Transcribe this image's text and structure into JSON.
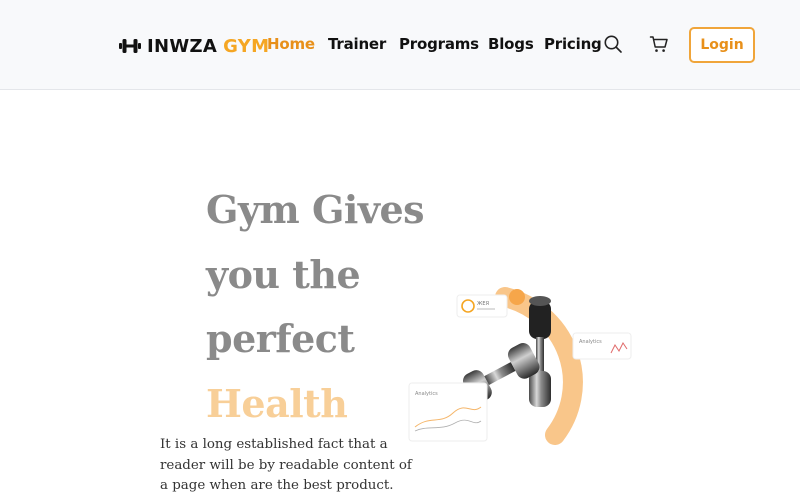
{
  "brand": {
    "name": "INWZA",
    "accent": "GYM",
    "accent_color": "#f5a623"
  },
  "nav": {
    "items": [
      {
        "label": "Home",
        "active": true
      },
      {
        "label": "Trainer",
        "active": false
      },
      {
        "label": "Programs",
        "active": false
      },
      {
        "label": "Blogs",
        "active": false
      },
      {
        "label": "Pricing",
        "active": false
      }
    ]
  },
  "header_icons": {
    "search": "search-icon",
    "cart": "cart-icon"
  },
  "login": {
    "label": "Login"
  },
  "hero": {
    "title_lines": [
      "Gym Gives",
      "you the",
      "perfect"
    ],
    "title_highlight": "Health",
    "title_color": "#8a8a8a",
    "highlight_color": "#f8cf98",
    "description": "It is a long established fact that a reader will be by readable content of a page when are the best product."
  },
  "illustration": {
    "card_top": "ЖЕЯ",
    "card_right": "Analytics",
    "card_left": "Analytics"
  }
}
